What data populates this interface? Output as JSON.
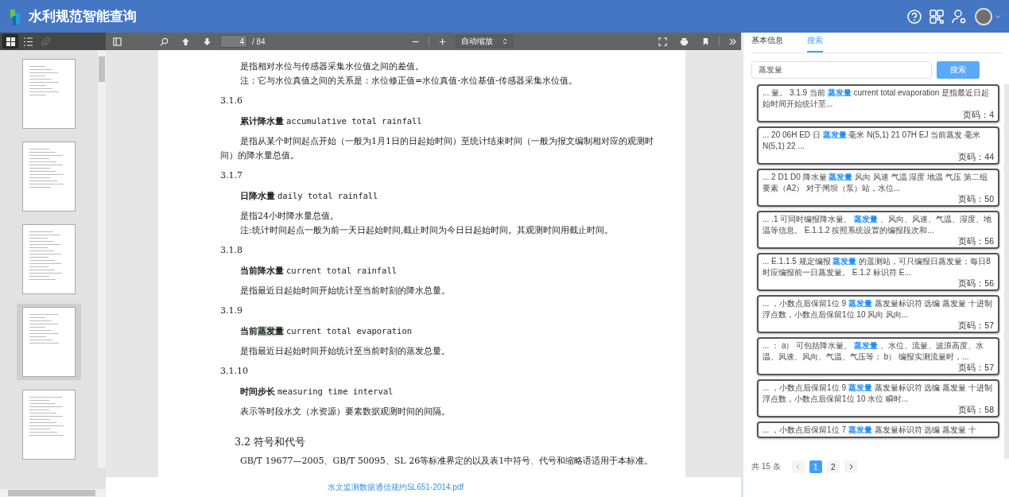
{
  "header": {
    "title": "水利规范智能查询"
  },
  "pdf_toolbar": {
    "sidebar_views": [
      {
        "kind": "thumbnails",
        "selected": true,
        "disabled": false
      },
      {
        "kind": "outline",
        "selected": false,
        "disabled": false
      },
      {
        "kind": "attachments",
        "selected": false,
        "disabled": true
      }
    ],
    "page_number": "4",
    "page_count": "/ 84",
    "zoom": "自动缩放"
  },
  "thumbnails": [
    {
      "selected": false
    },
    {
      "selected": false
    },
    {
      "selected": false
    },
    {
      "selected": true
    },
    {
      "selected": false
    }
  ],
  "document": {
    "blocks": [
      {
        "kind": "para",
        "text": "是指相对水位与传感器采集水位值之间的差值。"
      },
      {
        "kind": "note",
        "text": "注：它与水位真值之间的关系是：水位修正值=水位真值-水位基值-传感器采集水位值。"
      },
      {
        "kind": "number",
        "text": "3.1.6"
      },
      {
        "kind": "term",
        "segments": [
          {
            "text": "累计降水量",
            "highlighted": false
          }
        ],
        "en": "accumulative total rainfall"
      },
      {
        "kind": "para",
        "text": "是指从某个时间起点开始（一般为1月1日的日起始时间）至统计结束时间（一般为报文编制相对应的观测时间）的降水量总值。"
      },
      {
        "kind": "number",
        "text": "3.1.7"
      },
      {
        "kind": "term",
        "segments": [
          {
            "text": "日降水量",
            "highlighted": false
          }
        ],
        "en": "daily total rainfall"
      },
      {
        "kind": "para",
        "text": "是指24小时降水量总值。"
      },
      {
        "kind": "note",
        "text": "注:统计时间起点一般为前一天日起始时间,截止时间为今日日起始时间。其观测时间用截止时间。"
      },
      {
        "kind": "number",
        "text": "3.1.8"
      },
      {
        "kind": "term",
        "segments": [
          {
            "text": "当前降水量",
            "highlighted": false
          }
        ],
        "en": "current total rainfall"
      },
      {
        "kind": "para",
        "text": "是指最近日起始时间开始统计至当前时刻的降水总量。"
      },
      {
        "kind": "number",
        "text": "3.1.9"
      },
      {
        "kind": "term",
        "segments": [
          {
            "text": "当前",
            "highlighted": false
          },
          {
            "text": "蒸发量",
            "highlighted": true
          }
        ],
        "en": "current total evaporation"
      },
      {
        "kind": "para",
        "text": "是指最近日起始时间开始统计至当前时刻的蒸发总量。"
      },
      {
        "kind": "number",
        "text": "3.1.10"
      },
      {
        "kind": "term",
        "segments": [
          {
            "text": "时间步长",
            "highlighted": false
          }
        ],
        "en": "measuring time interval"
      },
      {
        "kind": "para",
        "text": "表示等时段水文（水资源）要素数据观测时间的间隔。"
      },
      {
        "kind": "heading",
        "text": "3.2  符号和代号"
      },
      {
        "kind": "para",
        "text": "GB/T 19677—2005、GB/T 50095、SL 26等标准界定的以及表1中符号、代号和缩略语适用于本标准。"
      }
    ]
  },
  "file_link": "水文监测数据通信规约SL651-2014.pdf",
  "panel": {
    "tabs": [
      {
        "label": "基本信息",
        "selected": false
      },
      {
        "label": "搜索",
        "selected": true
      }
    ],
    "search": {
      "value": "蒸发量",
      "button": "搜索"
    },
    "results": [
      {
        "snippet": "... 量。 3.1.9 当前 **蒸发量** current total evaporation 是指最近日起始时间开始统计至...",
        "page": "页码：4"
      },
      {
        "snippet": "... 20 06H ED 日 **蒸发量** 毫米 N(5,1) 21 07H EJ 当前蒸发 毫米 N(5,1) 22 ...",
        "page": "页码：44"
      },
      {
        "snippet": "... 2 D1 D0 降水量 **蒸发量** 风向 风速 气温 湿度 地温 气压 第二组要素（A2） 对于闸坝（泵）站，水位...",
        "page": "页码：50"
      },
      {
        "snippet": "... .1 可同时编报降水量、 **蒸发量** 、风向、风速、气温、湿度、地温等信息。 E.1.1.2 按照系统设置的编报段次和...",
        "page": "页码：56"
      },
      {
        "snippet": "... E.1.1.5 规定编报 **蒸发量** 的遥测站，可只编报日蒸发量；每日8时应编报前一日蒸发量。 E.1.2 标识符 E...",
        "page": "页码：56"
      },
      {
        "snippet": "... ，小数点后保留1位 9 **蒸发量** 蒸发量标识符 选编 蒸发量 十进制浮点数，小数点后保留1位 10 风向 风向...",
        "page": "页码：57"
      },
      {
        "snippet": "... ： a） 可包括降水量、 **蒸发量** 、水位、流量、波浪高度、水温、风速、风向、气温、气压等； b） 编报实测流量时，...",
        "page": "页码：57"
      },
      {
        "snippet": "... ，小数点后保留1位 9 **蒸发量** 蒸发量标识符 选编 蒸发量 十进制浮点数，小数点后保留1位 10 水位 瞬时...",
        "page": "页码：58"
      },
      {
        "snippet": "... ，小数点后保留1位 7 **蒸发量** 蒸发量标识符 选编 蒸发量 十"
      }
    ],
    "pagination": {
      "total": "共 15 条",
      "prev": {
        "disabled": true
      },
      "pages": [
        {
          "label": "1",
          "selected": true
        },
        {
          "label": "2",
          "selected": false
        }
      ],
      "next": {
        "disabled": false
      }
    }
  }
}
